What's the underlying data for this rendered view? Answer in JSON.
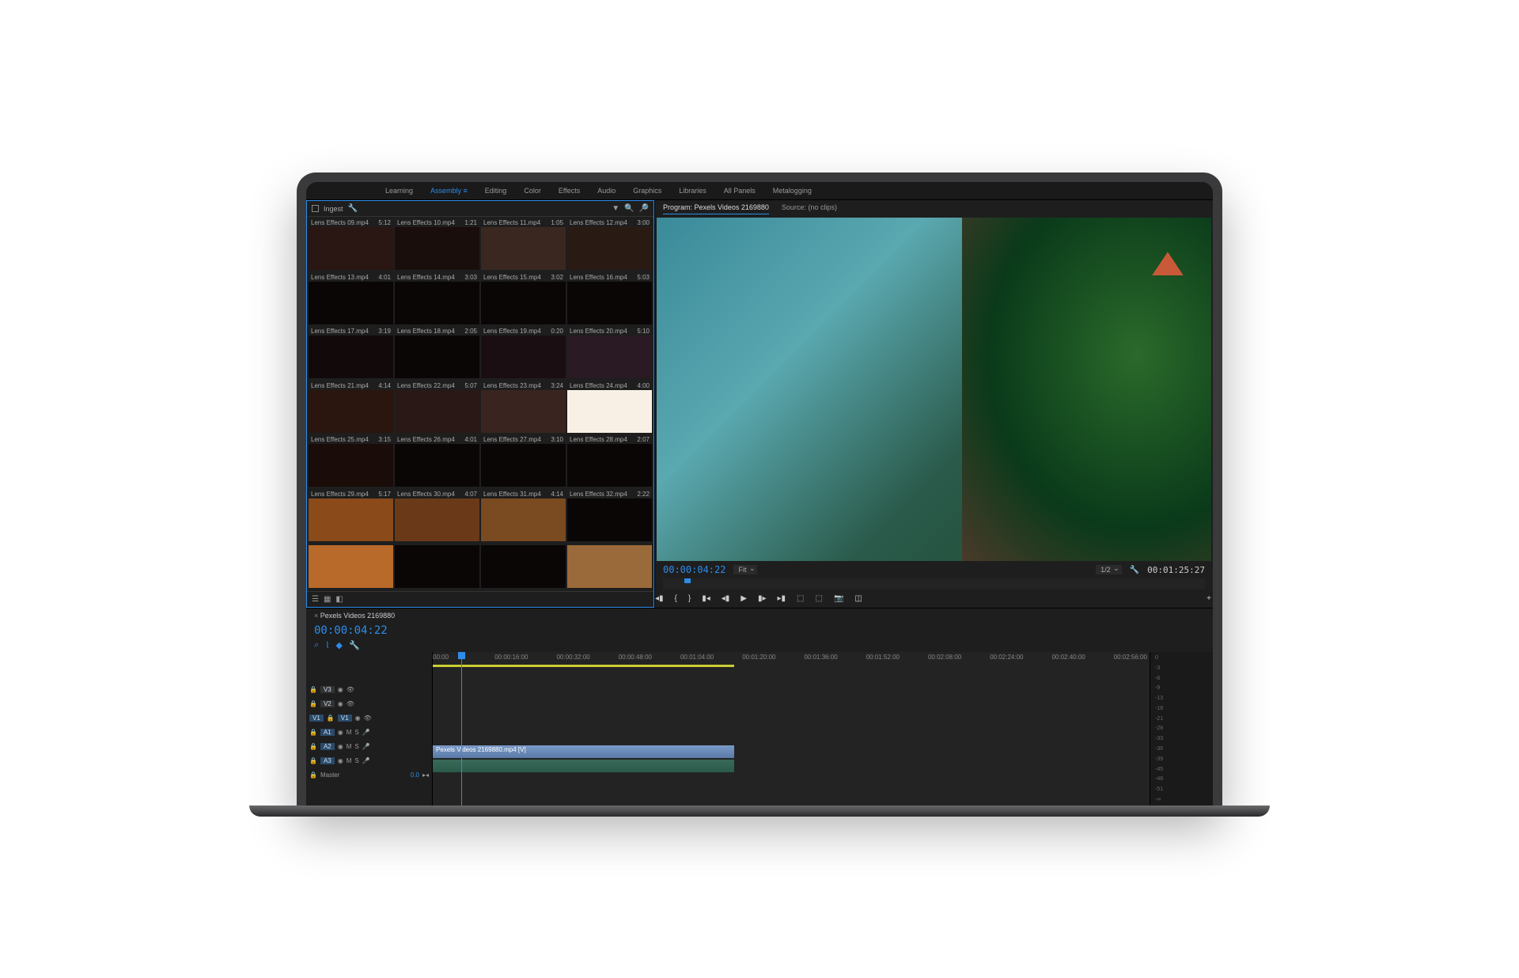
{
  "workspaces": [
    "Learning",
    "Assembly",
    "Editing",
    "Color",
    "Effects",
    "Audio",
    "Graphics",
    "Libraries",
    "All Panels",
    "Metalogging"
  ],
  "active_workspace": 1,
  "project": {
    "ingest_label": "Ingest",
    "clips": [
      {
        "name": "Lens Effects 09.mp4",
        "dur": "5:12",
        "bg": "#2a1612"
      },
      {
        "name": "Lens Effects 10.mp4",
        "dur": "1:21",
        "bg": "#1a0e0c"
      },
      {
        "name": "Lens Effects 11.mp4",
        "dur": "1:05",
        "bg": "#3a2820"
      },
      {
        "name": "Lens Effects 12.mp4",
        "dur": "3:00",
        "bg": "#2a1a14"
      },
      {
        "name": "Lens Effects 13.mp4",
        "dur": "4:01",
        "bg": "#0a0606"
      },
      {
        "name": "Lens Effects 14.mp4",
        "dur": "3:03",
        "bg": "#0a0606"
      },
      {
        "name": "Lens Effects 15.mp4",
        "dur": "3:02",
        "bg": "#0a0606"
      },
      {
        "name": "Lens Effects 16.mp4",
        "dur": "5:03",
        "bg": "#0a0606"
      },
      {
        "name": "Lens Effects 17.mp4",
        "dur": "3:19",
        "bg": "#120a0a"
      },
      {
        "name": "Lens Effects 18.mp4",
        "dur": "2:05",
        "bg": "#0a0606"
      },
      {
        "name": "Lens Effects 19.mp4",
        "dur": "0:20",
        "bg": "#1a0e12"
      },
      {
        "name": "Lens Effects 20.mp4",
        "dur": "5:10",
        "bg": "#2a1a24"
      },
      {
        "name": "Lens Effects 21.mp4",
        "dur": "4:14",
        "bg": "#2a160e"
      },
      {
        "name": "Lens Effects 22.mp4",
        "dur": "5:07",
        "bg": "#2a1816"
      },
      {
        "name": "Lens Effects 23.mp4",
        "dur": "3:24",
        "bg": "#3a2420"
      },
      {
        "name": "Lens Effects 24.mp4",
        "dur": "4:00",
        "bg": "#f8f0e4"
      },
      {
        "name": "Lens Effects 25.mp4",
        "dur": "3:15",
        "bg": "#1a0c08"
      },
      {
        "name": "Lens Effects 26.mp4",
        "dur": "4:01",
        "bg": "#0a0606"
      },
      {
        "name": "Lens Effects 27.mp4",
        "dur": "3:10",
        "bg": "#0a0606"
      },
      {
        "name": "Lens Effects 28.mp4",
        "dur": "2:07",
        "bg": "#0a0606"
      },
      {
        "name": "Lens Effects 29.mp4",
        "dur": "5:17",
        "bg": "#8a4a1a"
      },
      {
        "name": "Lens Effects 30.mp4",
        "dur": "4:07",
        "bg": "#6a3a18"
      },
      {
        "name": "Lens Effects 31.mp4",
        "dur": "4:14",
        "bg": "#7a4a20"
      },
      {
        "name": "Lens Effects 32.mp4",
        "dur": "2:22",
        "bg": "#0a0606"
      },
      {
        "name": "",
        "dur": "",
        "bg": "#b86a2a"
      },
      {
        "name": "",
        "dur": "",
        "bg": "#0a0606"
      },
      {
        "name": "",
        "dur": "",
        "bg": "#0a0606"
      },
      {
        "name": "",
        "dur": "",
        "bg": "#9a6a3a"
      }
    ]
  },
  "program": {
    "tab_program": "Program: Pexels Videos 2169880",
    "tab_source": "Source: (no clips)",
    "timecode_current": "00:00:04:22",
    "fit_label": "Fit",
    "zoom_label": "1/2",
    "timecode_duration": "00:01:25:27"
  },
  "timeline": {
    "sequence_name": "Pexels Videos 2169880",
    "timecode": "00:00:04:22",
    "ruler_marks": [
      "00:00",
      "00:00:16:00",
      "00:00:32:00",
      "00:00:48:00",
      "00:01:04:00",
      "00:01:20:00",
      "00:01:36:00",
      "00:01:52:00",
      "00:02:08:00",
      "00:02:24:00",
      "00:02:40:00",
      "00:02:56:00"
    ],
    "tracks": {
      "v3": "V3",
      "v2": "V2",
      "v1": "V1",
      "a1": "A1",
      "a2": "A2",
      "a3": "A3",
      "master": "Master",
      "master_val": "0.0"
    },
    "clip_name": "Pexels Videos 2169880.mp4 [V]",
    "playhead_pct": 4,
    "clip_start_pct": 0,
    "clip_end_pct": 42,
    "work_end_pct": 42
  },
  "meters": [
    "0",
    "-3",
    "-6",
    "-9",
    "-13",
    "-18",
    "-21",
    "-28",
    "-33",
    "-36",
    "-39",
    "-45",
    "-48",
    "-51",
    "-∞"
  ]
}
